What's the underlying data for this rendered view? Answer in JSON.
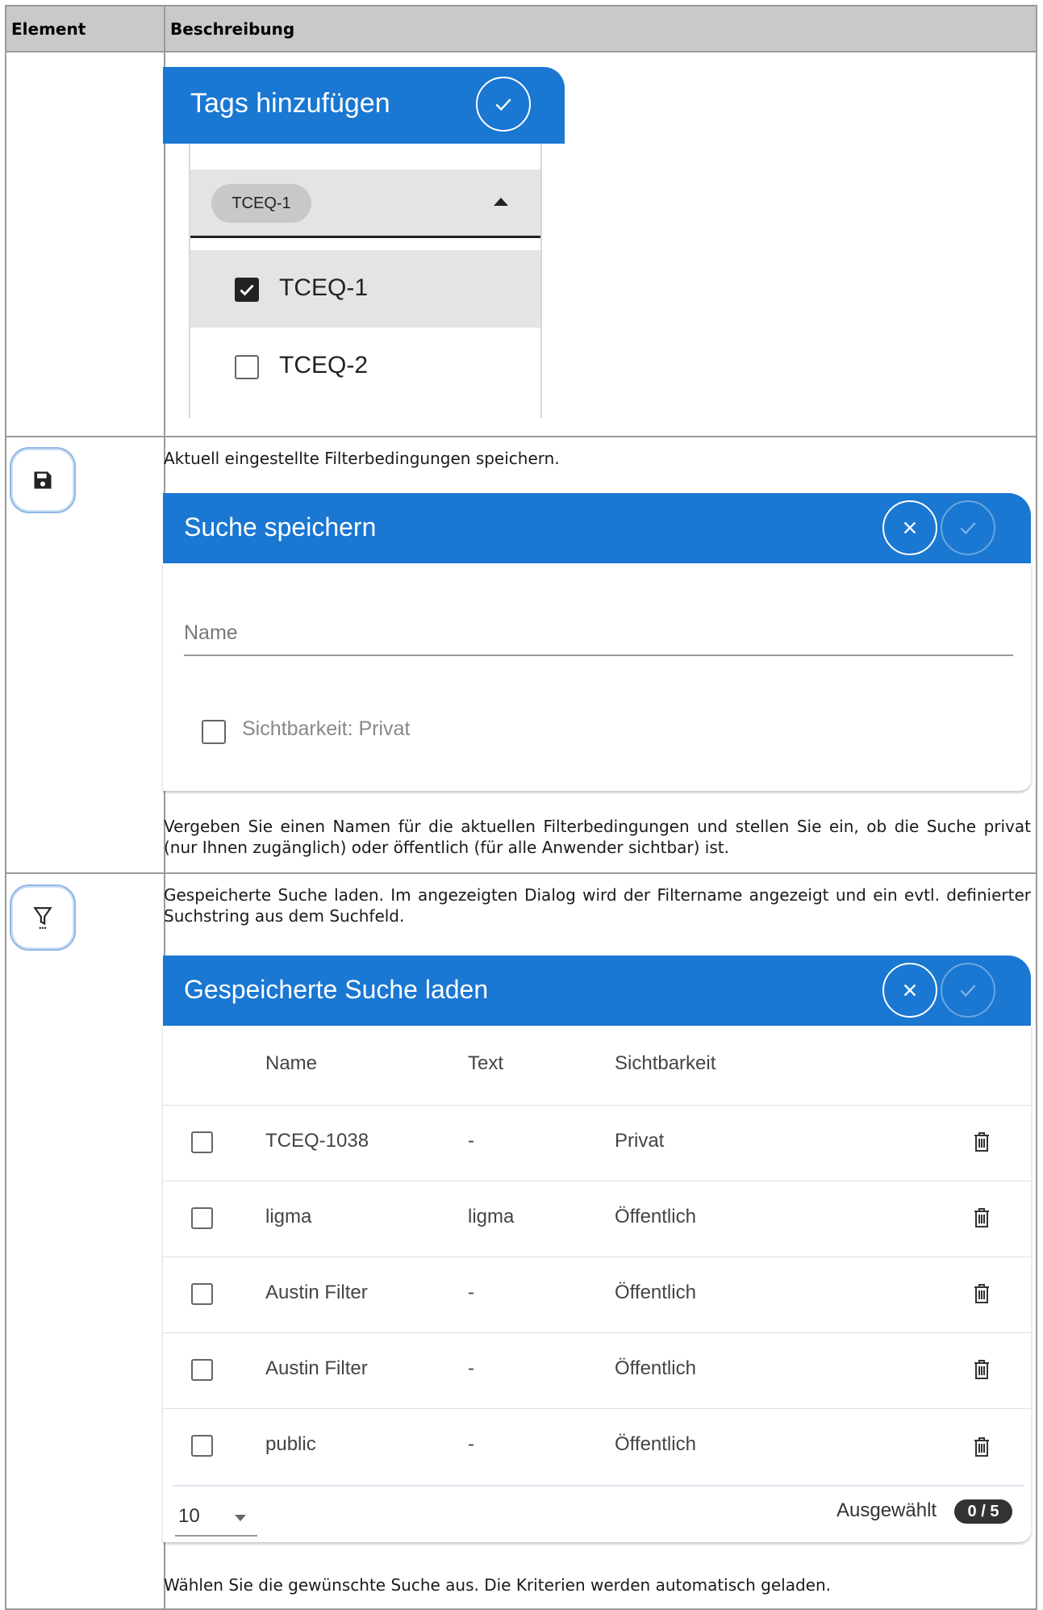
{
  "table": {
    "header": {
      "element": "Element",
      "description": "Beschreibung"
    }
  },
  "tags_dialog": {
    "title": "Tags hinzufügen",
    "chip": "TCEQ-1",
    "options": [
      {
        "label": "TCEQ-1",
        "checked": true
      },
      {
        "label": "TCEQ-2",
        "checked": false
      }
    ]
  },
  "save_row": {
    "icon": "floppy-disk-icon",
    "intro": "Aktuell eingestellte Filterbedingungen speichern.",
    "dialog": {
      "title": "Suche speichern",
      "name_placeholder": "Name",
      "visibility_label": "Sichtbarkeit: Privat"
    },
    "outro": "Vergeben Sie einen Namen für die aktuellen Filterbedingungen und stellen Sie ein, ob die Suche privat (nur Ihnen zugänglich) oder öffentlich (für alle Anwender sichtbar) ist."
  },
  "load_row": {
    "icon": "filter-icon",
    "intro": "Gespeicherte Suche laden. Im angezeigten Dialog wird der Filtername angezeigt und ein evtl. definierter Suchstring aus dem Suchfeld.",
    "dialog": {
      "title": "Gespeicherte Suche laden",
      "columns": [
        "Name",
        "Text",
        "Sichtbarkeit"
      ],
      "rows": [
        {
          "name": "TCEQ-1038",
          "text": "-",
          "visibility": "Privat"
        },
        {
          "name": "ligma",
          "text": "ligma",
          "visibility": "Öffentlich"
        },
        {
          "name": "Austin Filter",
          "text": "-",
          "visibility": "Öffentlich"
        },
        {
          "name": "Austin Filter",
          "text": "-",
          "visibility": "Öffentlich"
        },
        {
          "name": "public",
          "text": "-",
          "visibility": "Öffentlich"
        }
      ],
      "page_size": "10",
      "selected_label": "Ausgewählt",
      "selected_count": "0 / 5"
    },
    "outro": "Wählen Sie die gewünschte Suche aus. Die Kriterien werden automatisch geladen."
  },
  "colors": {
    "dialog_header": "#1a77d2",
    "table_header": "#c9c9c9",
    "border": "#9a9a9a"
  }
}
